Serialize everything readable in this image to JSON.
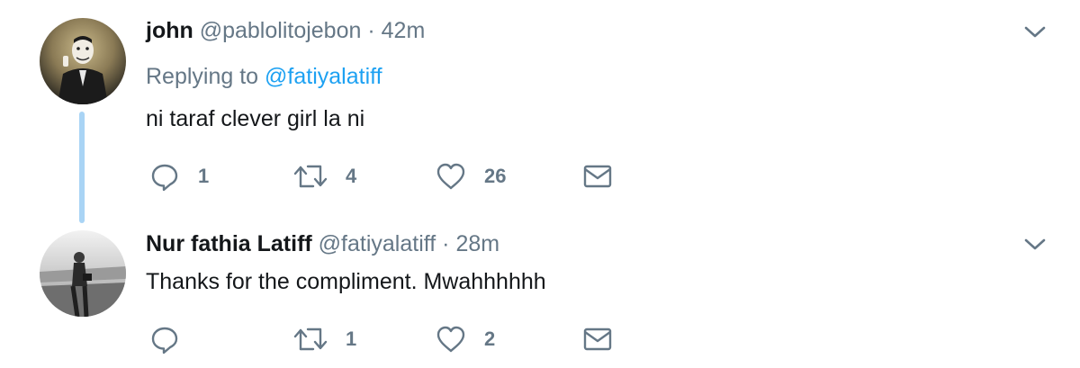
{
  "tweets": [
    {
      "name": "john",
      "handle": "@pablolitojebon",
      "separator": "·",
      "time": "42m",
      "replying_prefix": "Replying to",
      "replying_to": "@fatiyalatiff",
      "text": "ni taraf clever girl la ni",
      "reply_count": "1",
      "retweet_count": "4",
      "like_count": "26"
    },
    {
      "name": "Nur fathia Latiff",
      "handle": "@fatiyalatiff",
      "separator": "·",
      "time": "28m",
      "text": "Thanks for the compliment. Mwahhhhhh",
      "reply_count": "",
      "retweet_count": "1",
      "like_count": "2"
    }
  ],
  "colors": {
    "name": "#14171a",
    "meta": "#657786",
    "link": "#1da1f2",
    "thread_line": "#a9d4f5"
  },
  "icons": [
    "avatar",
    "reply-icon",
    "retweet-icon",
    "heart-icon",
    "envelope-icon",
    "chevron-down-icon"
  ]
}
